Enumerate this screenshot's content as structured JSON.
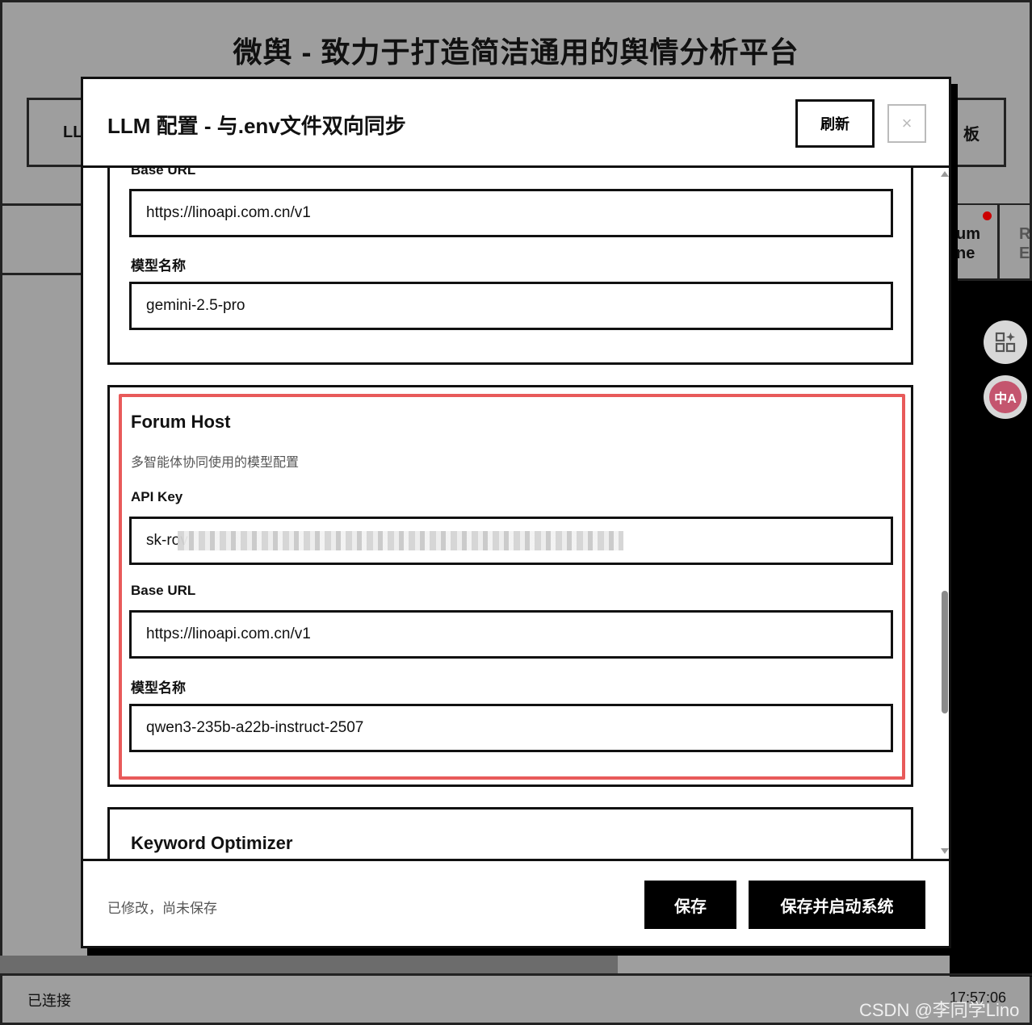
{
  "app": {
    "title": "微舆 - 致力于打造简洁通用的舆情分析平台",
    "tab_left_partial": "LL",
    "tab_right_partial": "板",
    "panel1_text": [
      "um",
      "ne"
    ],
    "panel2_text": [
      "R",
      "E"
    ],
    "status": "已连接",
    "time": "17:57:06",
    "watermark": "CSDN @李同学Lino"
  },
  "modal": {
    "title": "LLM 配置 - 与.env文件双向同步",
    "refresh_label": "刷新",
    "close_label": "×",
    "sections": [
      {
        "partial_label": "Base URL",
        "base_url_value": "https://linoapi.com.cn/v1",
        "model_label": "模型名称",
        "model_value": "gemini-2.5-pro"
      },
      {
        "title": "Forum Host",
        "description": "多智能体协同使用的模型配置",
        "api_key_label": "API Key",
        "api_key_value": "sk-rov",
        "base_url_label": "Base URL",
        "base_url_value": "https://linoapi.com.cn/v1",
        "model_label": "模型名称",
        "model_value": "qwen3-235b-a22b-instruct-2507"
      },
      {
        "title": "Keyword Optimizer"
      }
    ],
    "footer": {
      "status": "已修改，尚未保存",
      "save_label": "保存",
      "save_start_label": "保存并启动系统"
    }
  },
  "colors": {
    "highlight": "#e85a5a",
    "overlay": "#9e9e9e",
    "translate_icon_bg": "#c4556e"
  },
  "icons": {
    "apps_icon": "grid-sparkle-icon",
    "translate_icon": "translate-icon"
  }
}
